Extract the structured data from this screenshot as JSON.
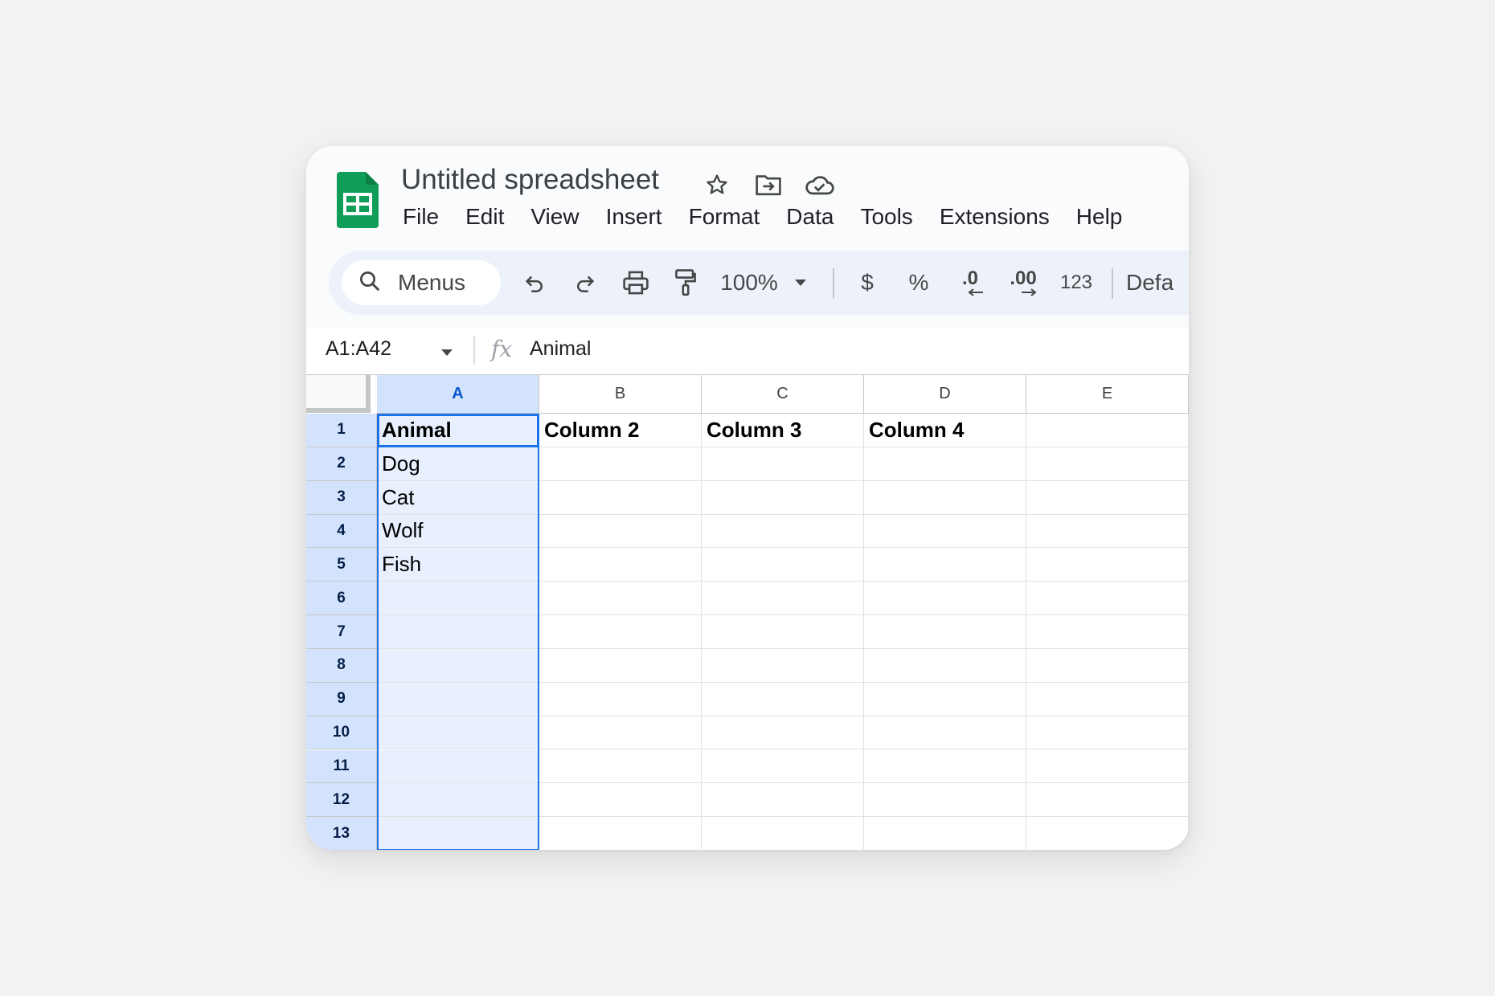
{
  "app": {
    "title": "Untitled spreadsheet",
    "accent": "#1a73e8",
    "logo_color": "#0f9d58",
    "title_icons": [
      "star-icon",
      "move-folder-icon",
      "cloud-status-icon"
    ]
  },
  "menubar": [
    "File",
    "Edit",
    "View",
    "Insert",
    "Format",
    "Data",
    "Tools",
    "Extensions",
    "Help"
  ],
  "toolbar": {
    "search_label": "Menus",
    "zoom": "100%",
    "currency": "$",
    "percent": "%",
    "decrease_decimal": ".0",
    "increase_decimal": ".00",
    "number_format": "123",
    "font_partial": "Defa",
    "icons": [
      "search-icon",
      "undo-icon",
      "redo-icon",
      "print-icon",
      "paint-format-icon",
      "chevron-down-icon"
    ]
  },
  "formula_bar": {
    "name_box": "A1:A42",
    "fx": "fx",
    "value": "Animal"
  },
  "grid": {
    "columns": [
      "A",
      "B",
      "C",
      "D",
      "E"
    ],
    "selected_column": "A",
    "rows": [
      "1",
      "2",
      "3",
      "4",
      "5",
      "6",
      "7",
      "8",
      "9",
      "10",
      "11",
      "12",
      "13"
    ],
    "cells": [
      [
        "Animal",
        "Column 2",
        "Column 3",
        "Column 4",
        ""
      ],
      [
        "Dog",
        "",
        "",
        "",
        ""
      ],
      [
        "Cat",
        "",
        "",
        "",
        ""
      ],
      [
        "Wolf",
        "",
        "",
        "",
        ""
      ],
      [
        "Fish",
        "",
        "",
        "",
        ""
      ],
      [
        "",
        "",
        "",
        "",
        ""
      ],
      [
        "",
        "",
        "",
        "",
        ""
      ],
      [
        "",
        "",
        "",
        "",
        ""
      ],
      [
        "",
        "",
        "",
        "",
        ""
      ],
      [
        "",
        "",
        "",
        "",
        ""
      ],
      [
        "",
        "",
        "",
        "",
        ""
      ],
      [
        "",
        "",
        "",
        "",
        ""
      ],
      [
        "",
        "",
        "",
        "",
        ""
      ]
    ]
  }
}
